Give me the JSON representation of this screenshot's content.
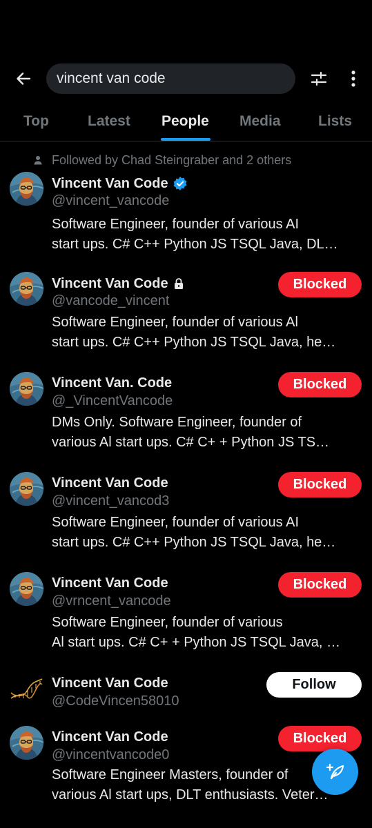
{
  "search": {
    "query": "vincent van code"
  },
  "tabs": [
    {
      "label": "Top"
    },
    {
      "label": "Latest"
    },
    {
      "label": "People"
    },
    {
      "label": "Media"
    },
    {
      "label": "Lists"
    }
  ],
  "active_tab": "People",
  "followed_by": "Followed by Chad Steingraber and 2 others",
  "users": [
    {
      "name": "Vincent Van Code",
      "handle": "@vincent_vancode",
      "badge": "verified-icon",
      "bio": [
        "Software Engineer, founder of various AI",
        "start ups. C# C++ Python JS TSQL Java, DL…"
      ],
      "action": ""
    },
    {
      "name": "Vincent Van Code",
      "handle": "@vancode_vincent",
      "badge": "lock-icon",
      "bio": [
        "Software Engineer, founder of various Al",
        "start ups. C#  C++ Python JS TSQL Java, he…"
      ],
      "action": "Blocked"
    },
    {
      "name": "Vincent Van. Code",
      "handle": "@_VincentVancode",
      "badge": "",
      "bio": [
        "DMs Only. Software Engineer, founder of",
        "various Al start ups. C# C+ + Python JS TS…"
      ],
      "action": "Blocked"
    },
    {
      "name": "Vincent Van Code",
      "handle": "@vincent_vancod3",
      "badge": "",
      "bio": [
        "Software Engineer, founder of various AI",
        "start ups. C# C++ Python JS TSQL Java, he…"
      ],
      "action": "Blocked"
    },
    {
      "name": "Vincent Van Code",
      "handle": "@vrncent_vancode",
      "badge": "",
      "bio": [
        "Software Engineer, founder of various",
        "Al start ups. C# C+ + Python JS TSQL Java, …"
      ],
      "action": "Blocked"
    },
    {
      "name": "Vincent Van Code",
      "handle": "@CodeVincen58010",
      "badge": "",
      "bio": [],
      "action": "Follow"
    },
    {
      "name": "Vincent Van Code",
      "handle": "@vincentvancode0",
      "badge": "",
      "bio": [
        "Software Engineer Masters, founder of",
        "various Al start ups, DLT enthusiasts. Veter…"
      ],
      "action": "Blocked"
    }
  ],
  "colors": {
    "accent": "#1d9bf0",
    "blocked": "#f4212e",
    "muted": "#71767b",
    "text": "#e7e9ea"
  }
}
